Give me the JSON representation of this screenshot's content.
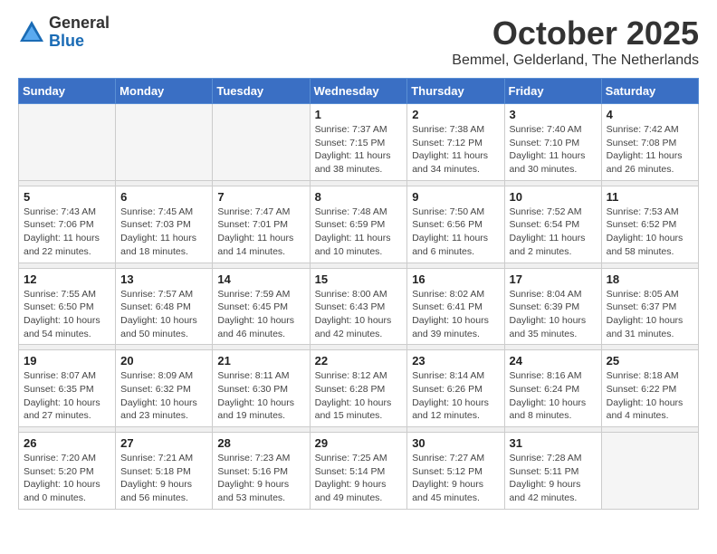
{
  "logo": {
    "general": "General",
    "blue": "Blue"
  },
  "header": {
    "month": "October 2025",
    "location": "Bemmel, Gelderland, The Netherlands"
  },
  "weekdays": [
    "Sunday",
    "Monday",
    "Tuesday",
    "Wednesday",
    "Thursday",
    "Friday",
    "Saturday"
  ],
  "weeks": [
    [
      {
        "day": "",
        "info": ""
      },
      {
        "day": "",
        "info": ""
      },
      {
        "day": "",
        "info": ""
      },
      {
        "day": "1",
        "info": "Sunrise: 7:37 AM\nSunset: 7:15 PM\nDaylight: 11 hours\nand 38 minutes."
      },
      {
        "day": "2",
        "info": "Sunrise: 7:38 AM\nSunset: 7:12 PM\nDaylight: 11 hours\nand 34 minutes."
      },
      {
        "day": "3",
        "info": "Sunrise: 7:40 AM\nSunset: 7:10 PM\nDaylight: 11 hours\nand 30 minutes."
      },
      {
        "day": "4",
        "info": "Sunrise: 7:42 AM\nSunset: 7:08 PM\nDaylight: 11 hours\nand 26 minutes."
      }
    ],
    [
      {
        "day": "5",
        "info": "Sunrise: 7:43 AM\nSunset: 7:06 PM\nDaylight: 11 hours\nand 22 minutes."
      },
      {
        "day": "6",
        "info": "Sunrise: 7:45 AM\nSunset: 7:03 PM\nDaylight: 11 hours\nand 18 minutes."
      },
      {
        "day": "7",
        "info": "Sunrise: 7:47 AM\nSunset: 7:01 PM\nDaylight: 11 hours\nand 14 minutes."
      },
      {
        "day": "8",
        "info": "Sunrise: 7:48 AM\nSunset: 6:59 PM\nDaylight: 11 hours\nand 10 minutes."
      },
      {
        "day": "9",
        "info": "Sunrise: 7:50 AM\nSunset: 6:56 PM\nDaylight: 11 hours\nand 6 minutes."
      },
      {
        "day": "10",
        "info": "Sunrise: 7:52 AM\nSunset: 6:54 PM\nDaylight: 11 hours\nand 2 minutes."
      },
      {
        "day": "11",
        "info": "Sunrise: 7:53 AM\nSunset: 6:52 PM\nDaylight: 10 hours\nand 58 minutes."
      }
    ],
    [
      {
        "day": "12",
        "info": "Sunrise: 7:55 AM\nSunset: 6:50 PM\nDaylight: 10 hours\nand 54 minutes."
      },
      {
        "day": "13",
        "info": "Sunrise: 7:57 AM\nSunset: 6:48 PM\nDaylight: 10 hours\nand 50 minutes."
      },
      {
        "day": "14",
        "info": "Sunrise: 7:59 AM\nSunset: 6:45 PM\nDaylight: 10 hours\nand 46 minutes."
      },
      {
        "day": "15",
        "info": "Sunrise: 8:00 AM\nSunset: 6:43 PM\nDaylight: 10 hours\nand 42 minutes."
      },
      {
        "day": "16",
        "info": "Sunrise: 8:02 AM\nSunset: 6:41 PM\nDaylight: 10 hours\nand 39 minutes."
      },
      {
        "day": "17",
        "info": "Sunrise: 8:04 AM\nSunset: 6:39 PM\nDaylight: 10 hours\nand 35 minutes."
      },
      {
        "day": "18",
        "info": "Sunrise: 8:05 AM\nSunset: 6:37 PM\nDaylight: 10 hours\nand 31 minutes."
      }
    ],
    [
      {
        "day": "19",
        "info": "Sunrise: 8:07 AM\nSunset: 6:35 PM\nDaylight: 10 hours\nand 27 minutes."
      },
      {
        "day": "20",
        "info": "Sunrise: 8:09 AM\nSunset: 6:32 PM\nDaylight: 10 hours\nand 23 minutes."
      },
      {
        "day": "21",
        "info": "Sunrise: 8:11 AM\nSunset: 6:30 PM\nDaylight: 10 hours\nand 19 minutes."
      },
      {
        "day": "22",
        "info": "Sunrise: 8:12 AM\nSunset: 6:28 PM\nDaylight: 10 hours\nand 15 minutes."
      },
      {
        "day": "23",
        "info": "Sunrise: 8:14 AM\nSunset: 6:26 PM\nDaylight: 10 hours\nand 12 minutes."
      },
      {
        "day": "24",
        "info": "Sunrise: 8:16 AM\nSunset: 6:24 PM\nDaylight: 10 hours\nand 8 minutes."
      },
      {
        "day": "25",
        "info": "Sunrise: 8:18 AM\nSunset: 6:22 PM\nDaylight: 10 hours\nand 4 minutes."
      }
    ],
    [
      {
        "day": "26",
        "info": "Sunrise: 7:20 AM\nSunset: 5:20 PM\nDaylight: 10 hours\nand 0 minutes."
      },
      {
        "day": "27",
        "info": "Sunrise: 7:21 AM\nSunset: 5:18 PM\nDaylight: 9 hours\nand 56 minutes."
      },
      {
        "day": "28",
        "info": "Sunrise: 7:23 AM\nSunset: 5:16 PM\nDaylight: 9 hours\nand 53 minutes."
      },
      {
        "day": "29",
        "info": "Sunrise: 7:25 AM\nSunset: 5:14 PM\nDaylight: 9 hours\nand 49 minutes."
      },
      {
        "day": "30",
        "info": "Sunrise: 7:27 AM\nSunset: 5:12 PM\nDaylight: 9 hours\nand 45 minutes."
      },
      {
        "day": "31",
        "info": "Sunrise: 7:28 AM\nSunset: 5:11 PM\nDaylight: 9 hours\nand 42 minutes."
      },
      {
        "day": "",
        "info": ""
      }
    ]
  ]
}
